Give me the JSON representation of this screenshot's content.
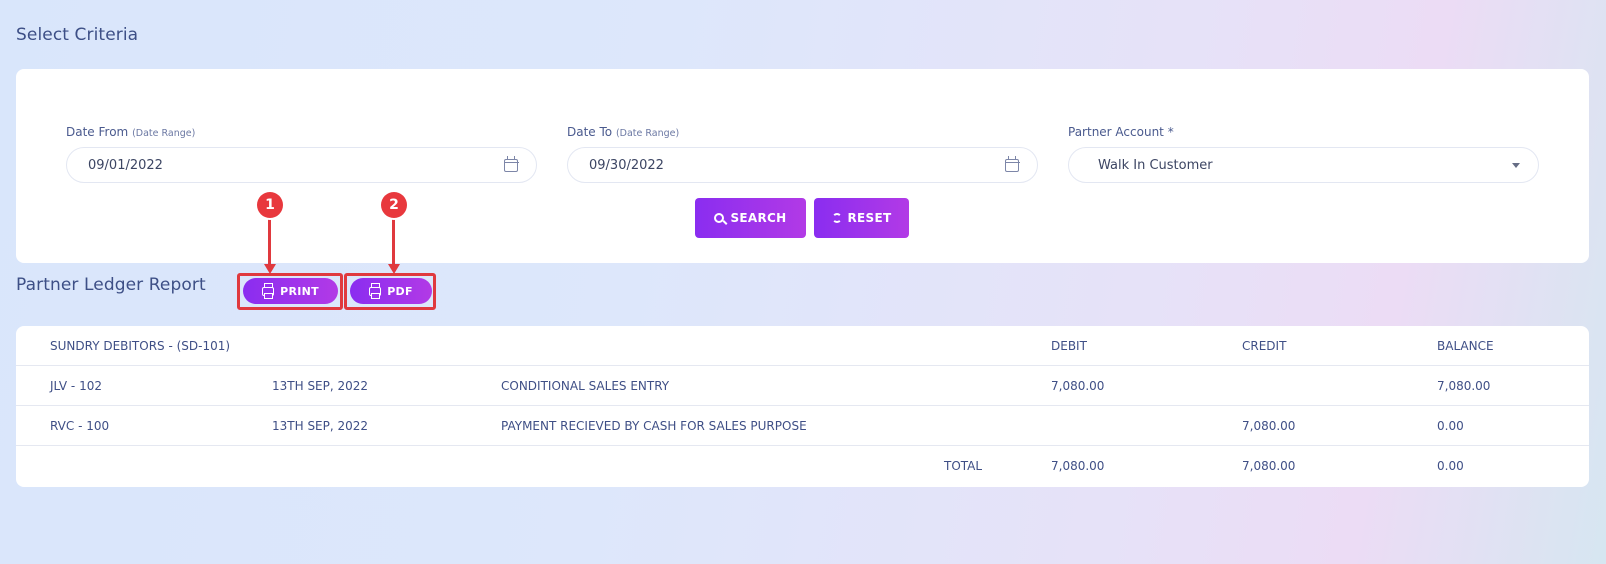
{
  "criteria": {
    "title": "Select Criteria",
    "date_from": {
      "label": "Date From",
      "hint": "(Date Range)",
      "value": "09/01/2022"
    },
    "date_to": {
      "label": "Date To",
      "hint": "(Date Range)",
      "value": "09/30/2022"
    },
    "partner": {
      "label": "Partner Account *",
      "value": "Walk In Customer"
    },
    "search_label": "SEARCH",
    "reset_label": "RESET"
  },
  "report": {
    "title": "Partner Ledger Report",
    "print_label": "PRINT",
    "pdf_label": "PDF"
  },
  "annotations": {
    "badge_1": "1",
    "badge_2": "2",
    "color": "#e0393e"
  },
  "icons": {
    "calendar": "calendar-icon",
    "dropdown": "chevron-down-icon",
    "search": "search-icon",
    "reset": "refresh-icon",
    "print": "printer-icon"
  },
  "colors": {
    "accent_start": "#8a2df0",
    "accent_end": "#b23ae6",
    "text": "#3f4f86"
  },
  "table": {
    "header": {
      "account": "SUNDRY DEBITORS - (SD-101)",
      "debit": "DEBIT",
      "credit": "CREDIT",
      "balance": "BALANCE"
    },
    "rows": [
      {
        "ref": "JLV - 102",
        "date": "13TH SEP, 2022",
        "description": "CONDITIONAL SALES ENTRY",
        "debit": "7,080.00",
        "credit": "",
        "balance": "7,080.00"
      },
      {
        "ref": "RVC - 100",
        "date": "13TH SEP, 2022",
        "description": "PAYMENT RECIEVED BY CASH FOR SALES PURPOSE",
        "debit": "",
        "credit": "7,080.00",
        "balance": "0.00"
      }
    ],
    "total": {
      "label": "TOTAL",
      "debit": "7,080.00",
      "credit": "7,080.00",
      "balance": "0.00"
    }
  }
}
